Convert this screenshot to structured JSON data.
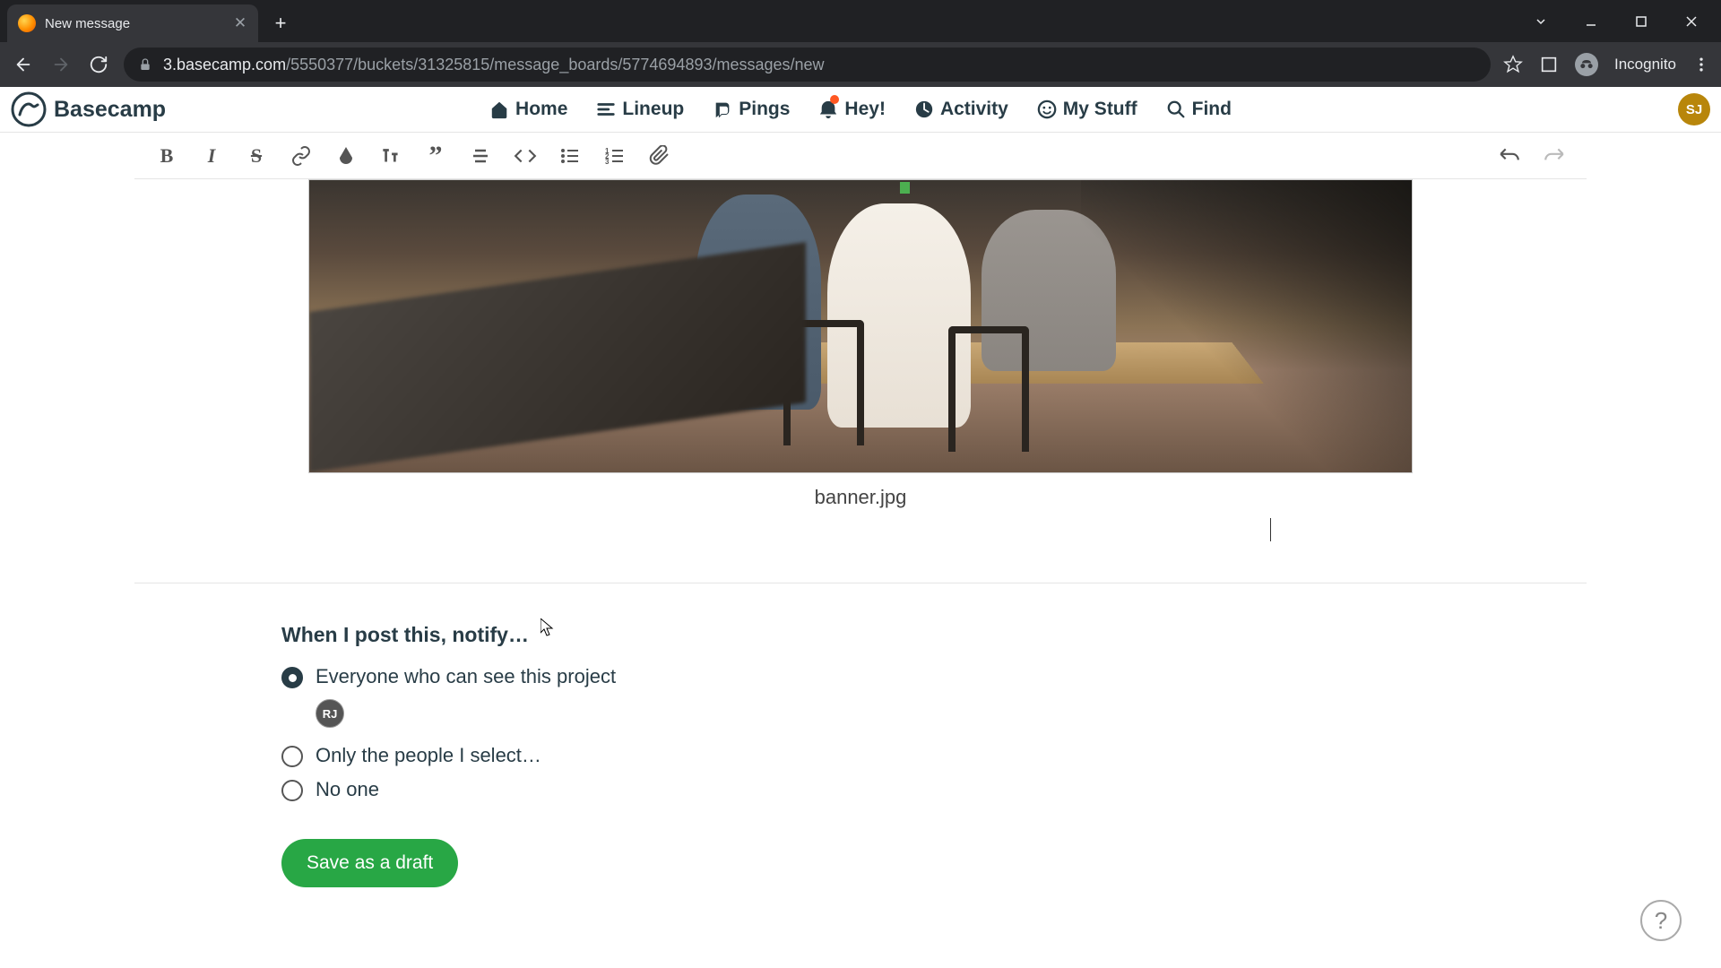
{
  "browser": {
    "tab_title": "New message",
    "url_host": "3.basecamp.com",
    "url_path": "/5550377/buckets/31325815/message_boards/5774694893/messages/new",
    "incognito_label": "Incognito"
  },
  "header": {
    "logo_text": "Basecamp",
    "nav": {
      "home": "Home",
      "lineup": "Lineup",
      "pings": "Pings",
      "hey": "Hey!",
      "activity": "Activity",
      "mystuff": "My Stuff",
      "find": "Find"
    },
    "avatar_initials": "SJ"
  },
  "editor": {
    "attachment_caption": "banner.jpg"
  },
  "notify": {
    "title": "When I post this, notify…",
    "options": {
      "everyone": "Everyone who can see this project",
      "select": "Only the people I select…",
      "none": "No one"
    },
    "subscriber_initials": "RJ"
  },
  "actions": {
    "save_draft": "Save as a draft"
  },
  "help_label": "?"
}
